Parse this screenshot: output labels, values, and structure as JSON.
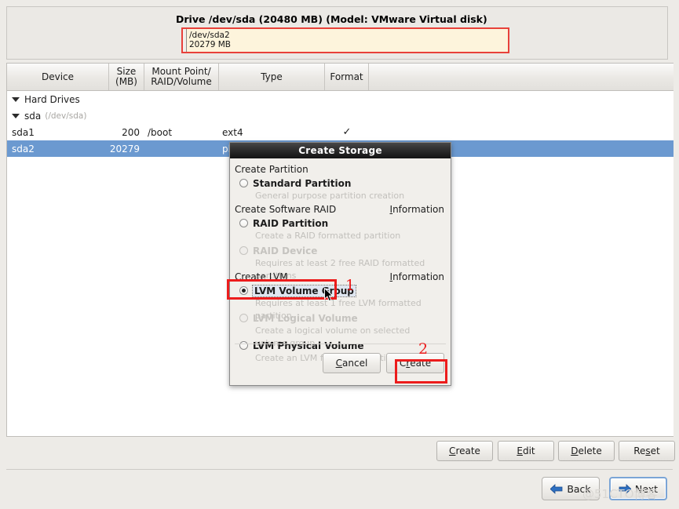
{
  "drive_panel": {
    "title": "Drive /dev/sda (20480 MB) (Model: VMware Virtual disk)",
    "segments": [
      {
        "name": "",
        "size": ""
      },
      {
        "name": "/dev/sda2",
        "size": "20279 MB"
      }
    ],
    "selection_color": "#e8413a",
    "fill_color": "#fdf4dc"
  },
  "table": {
    "columns": [
      "Device",
      "Size\n(MB)",
      "Mount Point/\nRAID/Volume",
      "Type",
      "Format"
    ],
    "column_labels": {
      "device": "Device",
      "size_l1": "Size",
      "size_l2": "(MB)",
      "mount_l1": "Mount Point/",
      "mount_l2": "RAID/Volume",
      "type": "Type",
      "format": "Format"
    },
    "rows": [
      {
        "device": "Hard Drives",
        "detail": "",
        "size": "",
        "mount": "",
        "type": "",
        "format": "",
        "level": 0,
        "expander": "expanded",
        "selected": false
      },
      {
        "device": "sda",
        "detail": "(/dev/sda)",
        "size": "",
        "mount": "",
        "type": "",
        "format": "",
        "level": 1,
        "expander": "expanded",
        "selected": false
      },
      {
        "device": "sda1",
        "detail": "",
        "size": "200",
        "mount": "/boot",
        "type": "ext4",
        "format": "✓",
        "level": 2,
        "expander": "none",
        "selected": false
      },
      {
        "device": "sda2",
        "detail": "",
        "size": "20279",
        "mount": "",
        "type": "physical volume (LVM)",
        "format": "✓",
        "level": 2,
        "expander": "none",
        "selected": true
      }
    ],
    "selected_row_color": "#6b99d0"
  },
  "actions": {
    "create": {
      "pre": "C",
      "mnemonic": "",
      "label": "Create"
    },
    "edit": {
      "label": "Edit"
    },
    "delete": {
      "label": "Delete"
    },
    "reset": {
      "label": "Reset"
    }
  },
  "action_buttons": [
    {
      "name": "create",
      "label": "Create",
      "mnemonic_index": 0
    },
    {
      "name": "edit",
      "label": "Edit",
      "mnemonic_index": 0
    },
    {
      "name": "delete",
      "label": "Delete",
      "mnemonic_index": 0
    },
    {
      "name": "reset",
      "label": "Reset",
      "mnemonic_index": 2
    }
  ],
  "nav": {
    "back": "Back",
    "next": "Next",
    "back_arrow": "←",
    "next_arrow": "→"
  },
  "watermark": "@51CTO博客",
  "dialog": {
    "title": "Create Storage",
    "groups": [
      {
        "heading": "Create Partition",
        "info": null,
        "options": [
          {
            "label": "Standard Partition",
            "description": "General purpose partition creation",
            "state": "enabled",
            "selected": false
          }
        ]
      },
      {
        "heading": "Create Software RAID",
        "info": "Information",
        "options": [
          {
            "label": "RAID Partition",
            "description": "Create a RAID formatted partition",
            "state": "enabled",
            "selected": false
          },
          {
            "label": "RAID Device",
            "description": "Requires at least 2 free RAID formatted partitions",
            "state": "disabled",
            "selected": false
          }
        ]
      },
      {
        "heading": "Create LVM",
        "info": "Information",
        "options": [
          {
            "label": "LVM Volume Group",
            "description": "Requires at least 1 free LVM formatted partition",
            "state": "enabled",
            "selected": true
          },
          {
            "label": "LVM Logical Volume",
            "description": "Create a logical volume on selected volume group",
            "state": "disabled",
            "selected": false
          },
          {
            "label": "LVM Physical Volume",
            "description": "Create an LVM formatted partition",
            "state": "enabled",
            "selected": false
          }
        ]
      }
    ],
    "buttons": {
      "cancel": "Cancel",
      "create": "Create"
    }
  },
  "annotations": [
    {
      "number": "1",
      "target": "lvm-volume-group-option"
    },
    {
      "number": "2",
      "target": "dialog-create-button"
    }
  ],
  "annotation_color": "#ec1c1c"
}
